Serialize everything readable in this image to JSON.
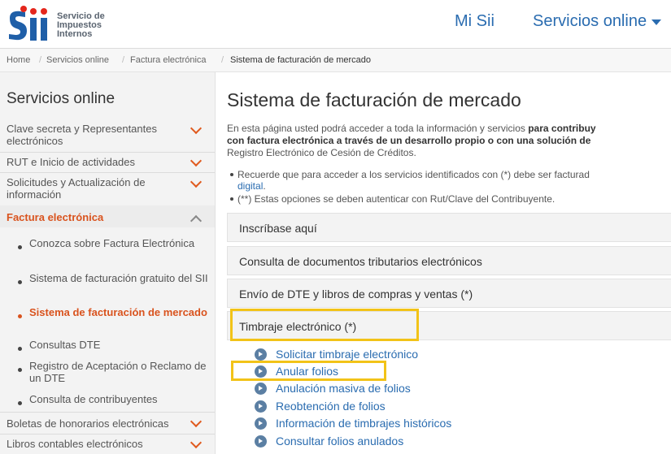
{
  "header": {
    "logo_line1": "Servicio de",
    "logo_line2": "Impuestos",
    "logo_line3": "Internos",
    "nav_mi_sii": "Mi Sii",
    "nav_servicios": "Servicios online",
    "brand_color": "#2a6cb0"
  },
  "breadcrumb": [
    "Home",
    "Servicios online",
    "Factura electrónica",
    "Sistema de facturación de mercado"
  ],
  "sidebar": {
    "title": "Servicios online",
    "items": [
      {
        "label": "Clave secreta y Representantes electrónicos"
      },
      {
        "label": "RUT e Inicio de actividades"
      },
      {
        "label": "Solicitudes y Actualización de información"
      },
      {
        "label": "Factura electrónica"
      }
    ],
    "sub_items": [
      {
        "label": "Conozca sobre Factura Electrónica"
      },
      {
        "label": "Sistema de facturación gratuito del SII"
      },
      {
        "label": "Sistema de facturación de mercado"
      },
      {
        "label": "Consultas DTE"
      },
      {
        "label": "Registro de Aceptación o Reclamo de un DTE"
      },
      {
        "label": "Consulta de contribuyentes"
      }
    ],
    "bottom_items": [
      {
        "label": "Boletas de honorarios electrónicas"
      },
      {
        "label": "Libros contables electrónicos"
      }
    ],
    "active_color": "#d9531e"
  },
  "main": {
    "title": "Sistema de facturación de mercado",
    "intro_1a": "En esta página usted podrá acceder a toda la información y servicios ",
    "intro_1b": "para contribuy",
    "intro_2": "con factura electrónica a través de un desarrollo propio o con una solución de",
    "intro_3": "Registro Electrónico de Cesión de Créditos.",
    "bullet_1": "Recuerde que para acceder a los servicios identificados con (*) debe ser facturad",
    "bullet_1_link": "digital",
    "bullet_1_end": ".",
    "bullet_2": "(**) Estas opciones se deben autenticar con Rut/Clave del Contribuyente.",
    "accordions": [
      {
        "label": "Inscríbase aquí"
      },
      {
        "label": "Consulta de documentos tributarios electrónicos"
      },
      {
        "label": "Envío de DTE y libros de compras y ventas (*)"
      },
      {
        "label": "Timbraje electrónico (*)"
      }
    ],
    "links": [
      {
        "label": "Solicitar timbraje electrónico"
      },
      {
        "label": "Anular folios"
      },
      {
        "label": "Anulación masiva de folios"
      },
      {
        "label": "Reobtención de folios"
      },
      {
        "label": "Información de timbrajes históricos"
      },
      {
        "label": "Consultar folios anulados"
      }
    ],
    "highlight_color": "#f2c318"
  }
}
